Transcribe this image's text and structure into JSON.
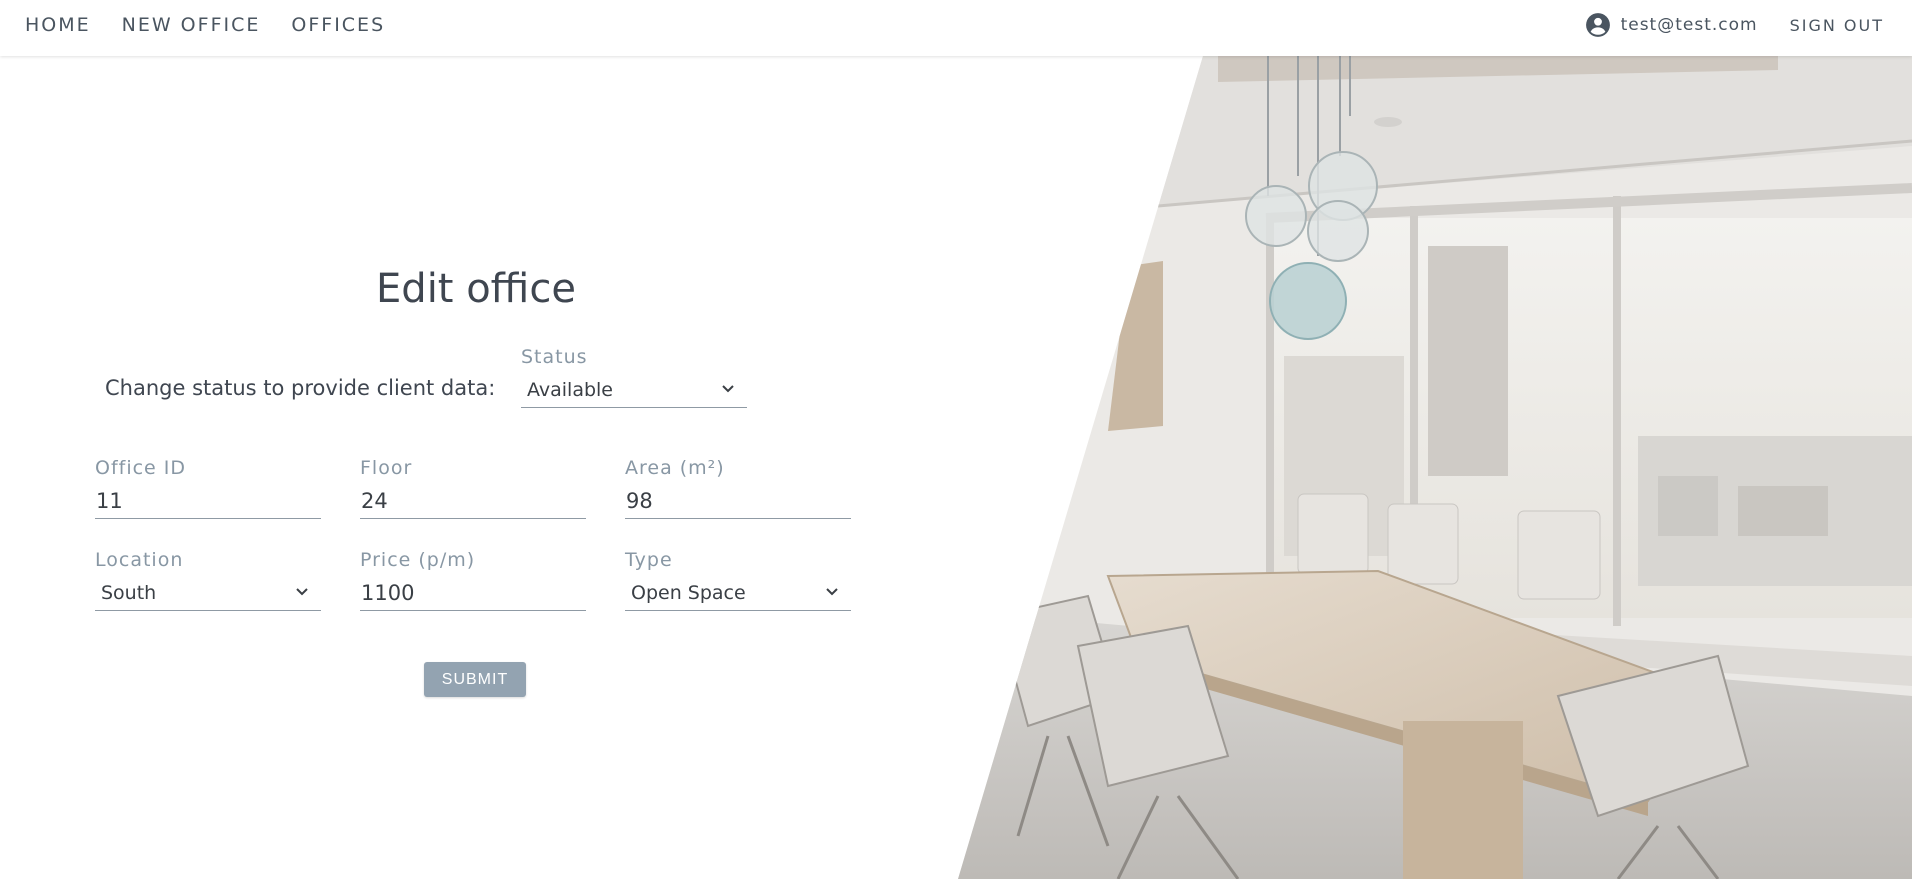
{
  "nav": {
    "links": [
      {
        "label": "HOME"
      },
      {
        "label": "NEW OFFICE"
      },
      {
        "label": "OFFICES"
      }
    ],
    "user_icon": "account-circle-icon",
    "user_email": "test@test.com",
    "signout_label": "SIGN OUT"
  },
  "form": {
    "title": "Edit office",
    "status_note": "Change status to provide client data:",
    "status": {
      "label": "Status",
      "value": "Available"
    },
    "office_id": {
      "label": "Office ID",
      "value": "11"
    },
    "floor": {
      "label": "Floor",
      "value": "24"
    },
    "area": {
      "label": "Area (m²)",
      "value": "98"
    },
    "location": {
      "label": "Location",
      "value": "South"
    },
    "price": {
      "label": "Price (p/m)",
      "value": "1100"
    },
    "type": {
      "label": "Type",
      "value": "Open Space"
    },
    "submit_label": "SUBMIT"
  },
  "image": {
    "subject": "meeting-room-photo"
  },
  "colors": {
    "nav_text": "#4a5560",
    "label": "#8897a4",
    "submit_bg": "#93a3b1"
  }
}
